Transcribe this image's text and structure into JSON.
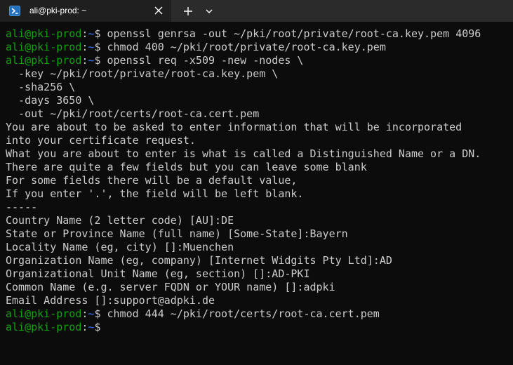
{
  "colors": {
    "background": "#0c0c0c",
    "foreground": "#cccccc",
    "prompt_user": "#13a10e",
    "prompt_path": "#3b78ff",
    "tab_active": "#1f1f1f",
    "titlebar": "#2b2b2b"
  },
  "titlebar": {
    "tab": {
      "icon": "powershell-icon",
      "title": "ali@pki-prod: ~",
      "close_icon": "close-icon"
    },
    "new_tab_icon": "plus-icon",
    "dropdown_icon": "chevron-down-icon"
  },
  "terminal": {
    "lines": [
      {
        "type": "prompt",
        "user": "ali@pki-prod",
        "sep": ":",
        "path": "~",
        "mark": "$ ",
        "cmd": "openssl genrsa -out ~/pki/root/private/root-ca.key.pem 4096"
      },
      {
        "type": "prompt",
        "user": "ali@pki-prod",
        "sep": ":",
        "path": "~",
        "mark": "$ ",
        "cmd": "chmod 400 ~/pki/root/private/root-ca.key.pem"
      },
      {
        "type": "prompt",
        "user": "ali@pki-prod",
        "sep": ":",
        "path": "~",
        "mark": "$ ",
        "cmd": "openssl req -x509 -new -nodes \\"
      },
      {
        "type": "out",
        "text": "  -key ~/pki/root/private/root-ca.key.pem \\"
      },
      {
        "type": "out",
        "text": "  -sha256 \\"
      },
      {
        "type": "out",
        "text": "  -days 3650 \\"
      },
      {
        "type": "out",
        "text": "  -out ~/pki/root/certs/root-ca.cert.pem"
      },
      {
        "type": "out",
        "text": "You are about to be asked to enter information that will be incorporated"
      },
      {
        "type": "out",
        "text": "into your certificate request."
      },
      {
        "type": "out",
        "text": "What you are about to enter is what is called a Distinguished Name or a DN."
      },
      {
        "type": "out",
        "text": "There are quite a few fields but you can leave some blank"
      },
      {
        "type": "out",
        "text": "For some fields there will be a default value,"
      },
      {
        "type": "out",
        "text": "If you enter '.', the field will be left blank."
      },
      {
        "type": "out",
        "text": "-----"
      },
      {
        "type": "out",
        "text": "Country Name (2 letter code) [AU]:DE"
      },
      {
        "type": "out",
        "text": "State or Province Name (full name) [Some-State]:Bayern"
      },
      {
        "type": "out",
        "text": "Locality Name (eg, city) []:Muenchen"
      },
      {
        "type": "out",
        "text": "Organization Name (eg, company) [Internet Widgits Pty Ltd]:AD"
      },
      {
        "type": "out",
        "text": "Organizational Unit Name (eg, section) []:AD-PKI"
      },
      {
        "type": "out",
        "text": "Common Name (e.g. server FQDN or YOUR name) []:adpki"
      },
      {
        "type": "out",
        "text": "Email Address []:support@adpki.de"
      },
      {
        "type": "prompt",
        "user": "ali@pki-prod",
        "sep": ":",
        "path": "~",
        "mark": "$ ",
        "cmd": "chmod 444 ~/pki/root/certs/root-ca.cert.pem"
      },
      {
        "type": "prompt",
        "user": "ali@pki-prod",
        "sep": ":",
        "path": "~",
        "mark": "$ ",
        "cmd": ""
      }
    ]
  }
}
